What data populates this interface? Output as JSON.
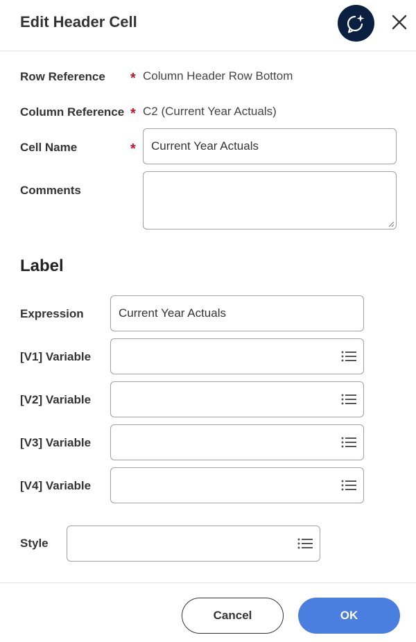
{
  "dialog": {
    "title": "Edit Header Cell",
    "ai_icon": "sparkle-chat-icon",
    "close_icon": "close-icon"
  },
  "form": {
    "row_reference": {
      "label": "Row Reference",
      "required": "*",
      "value": "Column Header Row Bottom"
    },
    "column_reference": {
      "label": "Column Reference",
      "required": "*",
      "value": "C2 (Current Year Actuals)"
    },
    "cell_name": {
      "label": "Cell Name",
      "required": "*",
      "value": "Current Year Actuals"
    },
    "comments": {
      "label": "Comments",
      "value": ""
    }
  },
  "label_section": {
    "title": "Label",
    "expression": {
      "label": "Expression",
      "value": "Current Year Actuals"
    },
    "variables": [
      {
        "label": "[V1] Variable",
        "value": ""
      },
      {
        "label": "[V2] Variable",
        "value": ""
      },
      {
        "label": "[V3] Variable",
        "value": ""
      },
      {
        "label": "[V4] Variable",
        "value": ""
      }
    ],
    "style": {
      "label": "Style",
      "value": ""
    }
  },
  "footer": {
    "cancel_label": "Cancel",
    "ok_label": "OK"
  },
  "colors": {
    "primary": "#4a7fe0",
    "ai_button": "#0b1f40",
    "required": "#c8102e"
  }
}
